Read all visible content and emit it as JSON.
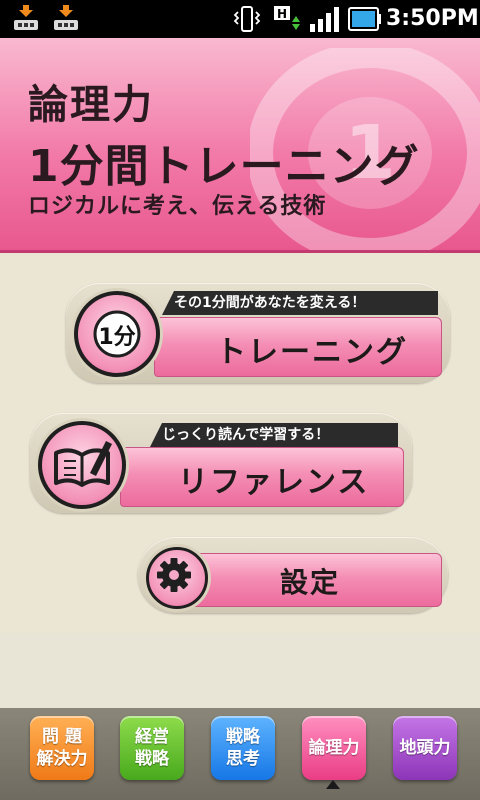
{
  "status_bar": {
    "time": "3:50PM",
    "icons": [
      "download-icon",
      "download-icon",
      "vibrate-icon",
      "hsdpa-data-icon",
      "signal-strength-icon",
      "battery-icon"
    ],
    "colors": {
      "battery": "#33a7e8",
      "background": "#000000"
    }
  },
  "header": {
    "title_line1": "論理力",
    "title_line2": "1分間トレーニング",
    "subtitle": "ロジカルに考え、伝える技術",
    "colors": {
      "top": "#f9b9d0",
      "bottom": "#e8588f"
    }
  },
  "menu": {
    "training": {
      "tagline": "その1分間があなたを変える！",
      "label": "トレーニング",
      "badge_text": "1分",
      "icon": "one-minute-badge-icon"
    },
    "reference": {
      "tagline": "じっくり読んで学習する！",
      "label": "リファレンス",
      "icon": "book-pen-icon"
    },
    "settings": {
      "label": "設定",
      "icon": "gear-icon"
    }
  },
  "dock": {
    "items": [
      {
        "line1": "問 題",
        "line2": "解決力",
        "color": "#f07a17"
      },
      {
        "line1": "経営",
        "line2": "戦略",
        "color": "#48a91c"
      },
      {
        "line1": "戦略",
        "line2": "思考",
        "color": "#1677e6"
      },
      {
        "line1": "論理力",
        "line2": "",
        "color": "#ea3d85",
        "selected": true
      },
      {
        "line1": "地頭力",
        "line2": "",
        "color": "#8d35b8"
      }
    ]
  }
}
